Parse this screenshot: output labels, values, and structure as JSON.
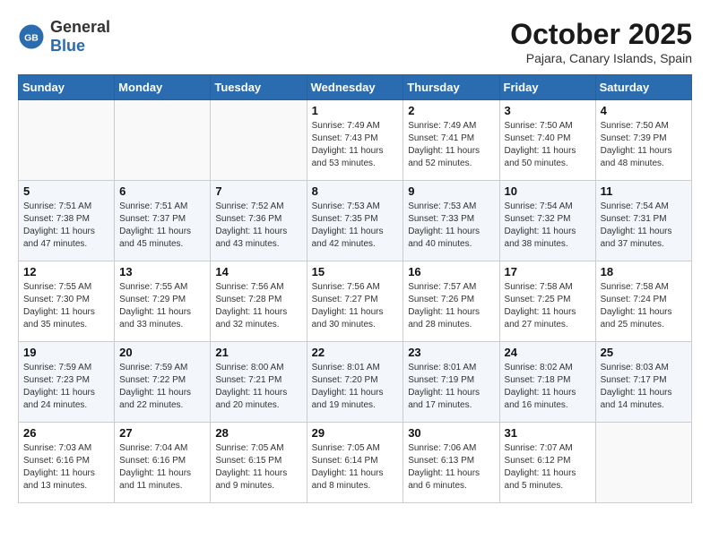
{
  "header": {
    "logo_general": "General",
    "logo_blue": "Blue",
    "month_year": "October 2025",
    "location": "Pajara, Canary Islands, Spain"
  },
  "weekdays": [
    "Sunday",
    "Monday",
    "Tuesday",
    "Wednesday",
    "Thursday",
    "Friday",
    "Saturday"
  ],
  "weeks": [
    [
      {
        "day": "",
        "sunrise": "",
        "sunset": "",
        "daylight": ""
      },
      {
        "day": "",
        "sunrise": "",
        "sunset": "",
        "daylight": ""
      },
      {
        "day": "",
        "sunrise": "",
        "sunset": "",
        "daylight": ""
      },
      {
        "day": "1",
        "sunrise": "Sunrise: 7:49 AM",
        "sunset": "Sunset: 7:43 PM",
        "daylight": "Daylight: 11 hours and 53 minutes."
      },
      {
        "day": "2",
        "sunrise": "Sunrise: 7:49 AM",
        "sunset": "Sunset: 7:41 PM",
        "daylight": "Daylight: 11 hours and 52 minutes."
      },
      {
        "day": "3",
        "sunrise": "Sunrise: 7:50 AM",
        "sunset": "Sunset: 7:40 PM",
        "daylight": "Daylight: 11 hours and 50 minutes."
      },
      {
        "day": "4",
        "sunrise": "Sunrise: 7:50 AM",
        "sunset": "Sunset: 7:39 PM",
        "daylight": "Daylight: 11 hours and 48 minutes."
      }
    ],
    [
      {
        "day": "5",
        "sunrise": "Sunrise: 7:51 AM",
        "sunset": "Sunset: 7:38 PM",
        "daylight": "Daylight: 11 hours and 47 minutes."
      },
      {
        "day": "6",
        "sunrise": "Sunrise: 7:51 AM",
        "sunset": "Sunset: 7:37 PM",
        "daylight": "Daylight: 11 hours and 45 minutes."
      },
      {
        "day": "7",
        "sunrise": "Sunrise: 7:52 AM",
        "sunset": "Sunset: 7:36 PM",
        "daylight": "Daylight: 11 hours and 43 minutes."
      },
      {
        "day": "8",
        "sunrise": "Sunrise: 7:53 AM",
        "sunset": "Sunset: 7:35 PM",
        "daylight": "Daylight: 11 hours and 42 minutes."
      },
      {
        "day": "9",
        "sunrise": "Sunrise: 7:53 AM",
        "sunset": "Sunset: 7:33 PM",
        "daylight": "Daylight: 11 hours and 40 minutes."
      },
      {
        "day": "10",
        "sunrise": "Sunrise: 7:54 AM",
        "sunset": "Sunset: 7:32 PM",
        "daylight": "Daylight: 11 hours and 38 minutes."
      },
      {
        "day": "11",
        "sunrise": "Sunrise: 7:54 AM",
        "sunset": "Sunset: 7:31 PM",
        "daylight": "Daylight: 11 hours and 37 minutes."
      }
    ],
    [
      {
        "day": "12",
        "sunrise": "Sunrise: 7:55 AM",
        "sunset": "Sunset: 7:30 PM",
        "daylight": "Daylight: 11 hours and 35 minutes."
      },
      {
        "day": "13",
        "sunrise": "Sunrise: 7:55 AM",
        "sunset": "Sunset: 7:29 PM",
        "daylight": "Daylight: 11 hours and 33 minutes."
      },
      {
        "day": "14",
        "sunrise": "Sunrise: 7:56 AM",
        "sunset": "Sunset: 7:28 PM",
        "daylight": "Daylight: 11 hours and 32 minutes."
      },
      {
        "day": "15",
        "sunrise": "Sunrise: 7:56 AM",
        "sunset": "Sunset: 7:27 PM",
        "daylight": "Daylight: 11 hours and 30 minutes."
      },
      {
        "day": "16",
        "sunrise": "Sunrise: 7:57 AM",
        "sunset": "Sunset: 7:26 PM",
        "daylight": "Daylight: 11 hours and 28 minutes."
      },
      {
        "day": "17",
        "sunrise": "Sunrise: 7:58 AM",
        "sunset": "Sunset: 7:25 PM",
        "daylight": "Daylight: 11 hours and 27 minutes."
      },
      {
        "day": "18",
        "sunrise": "Sunrise: 7:58 AM",
        "sunset": "Sunset: 7:24 PM",
        "daylight": "Daylight: 11 hours and 25 minutes."
      }
    ],
    [
      {
        "day": "19",
        "sunrise": "Sunrise: 7:59 AM",
        "sunset": "Sunset: 7:23 PM",
        "daylight": "Daylight: 11 hours and 24 minutes."
      },
      {
        "day": "20",
        "sunrise": "Sunrise: 7:59 AM",
        "sunset": "Sunset: 7:22 PM",
        "daylight": "Daylight: 11 hours and 22 minutes."
      },
      {
        "day": "21",
        "sunrise": "Sunrise: 8:00 AM",
        "sunset": "Sunset: 7:21 PM",
        "daylight": "Daylight: 11 hours and 20 minutes."
      },
      {
        "day": "22",
        "sunrise": "Sunrise: 8:01 AM",
        "sunset": "Sunset: 7:20 PM",
        "daylight": "Daylight: 11 hours and 19 minutes."
      },
      {
        "day": "23",
        "sunrise": "Sunrise: 8:01 AM",
        "sunset": "Sunset: 7:19 PM",
        "daylight": "Daylight: 11 hours and 17 minutes."
      },
      {
        "day": "24",
        "sunrise": "Sunrise: 8:02 AM",
        "sunset": "Sunset: 7:18 PM",
        "daylight": "Daylight: 11 hours and 16 minutes."
      },
      {
        "day": "25",
        "sunrise": "Sunrise: 8:03 AM",
        "sunset": "Sunset: 7:17 PM",
        "daylight": "Daylight: 11 hours and 14 minutes."
      }
    ],
    [
      {
        "day": "26",
        "sunrise": "Sunrise: 7:03 AM",
        "sunset": "Sunset: 6:16 PM",
        "daylight": "Daylight: 11 hours and 13 minutes."
      },
      {
        "day": "27",
        "sunrise": "Sunrise: 7:04 AM",
        "sunset": "Sunset: 6:16 PM",
        "daylight": "Daylight: 11 hours and 11 minutes."
      },
      {
        "day": "28",
        "sunrise": "Sunrise: 7:05 AM",
        "sunset": "Sunset: 6:15 PM",
        "daylight": "Daylight: 11 hours and 9 minutes."
      },
      {
        "day": "29",
        "sunrise": "Sunrise: 7:05 AM",
        "sunset": "Sunset: 6:14 PM",
        "daylight": "Daylight: 11 hours and 8 minutes."
      },
      {
        "day": "30",
        "sunrise": "Sunrise: 7:06 AM",
        "sunset": "Sunset: 6:13 PM",
        "daylight": "Daylight: 11 hours and 6 minutes."
      },
      {
        "day": "31",
        "sunrise": "Sunrise: 7:07 AM",
        "sunset": "Sunset: 6:12 PM",
        "daylight": "Daylight: 11 hours and 5 minutes."
      },
      {
        "day": "",
        "sunrise": "",
        "sunset": "",
        "daylight": ""
      }
    ]
  ]
}
